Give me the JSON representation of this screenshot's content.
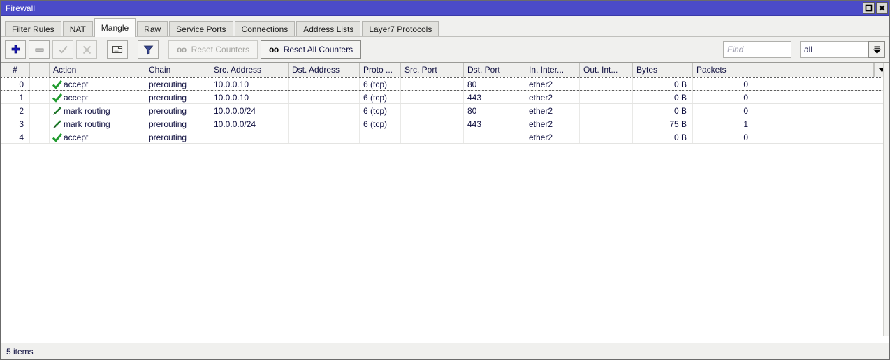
{
  "window": {
    "title": "Firewall",
    "titlebar_color": "#4b4bc8",
    "controls": [
      {
        "name": "maximize",
        "glyph": "maximize-icon"
      },
      {
        "name": "close",
        "glyph": "close-icon"
      }
    ]
  },
  "tabs": [
    {
      "label": "Filter Rules",
      "active": false
    },
    {
      "label": "NAT",
      "active": false
    },
    {
      "label": "Mangle",
      "active": true
    },
    {
      "label": "Raw",
      "active": false
    },
    {
      "label": "Service Ports",
      "active": false
    },
    {
      "label": "Connections",
      "active": false
    },
    {
      "label": "Address Lists",
      "active": false
    },
    {
      "label": "Layer7 Protocols",
      "active": false
    }
  ],
  "toolbar": {
    "buttons": [
      {
        "name": "add-button",
        "icon": "plus-icon",
        "enabled": true
      },
      {
        "name": "remove-button",
        "icon": "minus-icon",
        "enabled": true
      },
      {
        "name": "enable-button",
        "icon": "check-icon",
        "enabled": false
      },
      {
        "name": "disable-button",
        "icon": "cross-icon",
        "enabled": false
      },
      {
        "name": "comment-button",
        "icon": "comment-icon",
        "enabled": true
      },
      {
        "name": "filter-button",
        "icon": "funnel-icon",
        "enabled": true
      }
    ],
    "reset_counters": {
      "label": "Reset Counters",
      "badge": "oo",
      "enabled": false
    },
    "reset_all_counters": {
      "label": "Reset All Counters",
      "badge": "oo",
      "enabled": true
    },
    "find": {
      "placeholder": "Find",
      "value": ""
    },
    "filter_select": {
      "value": "all",
      "options": [
        "all"
      ]
    }
  },
  "table": {
    "columns": [
      {
        "key": "num",
        "label": "#",
        "width": 42,
        "align": "center"
      },
      {
        "key": "flags",
        "label": "",
        "width": 28,
        "align": "left"
      },
      {
        "key": "action",
        "label": "Action",
        "width": 137,
        "align": "left"
      },
      {
        "key": "chain",
        "label": "Chain",
        "width": 93,
        "align": "left"
      },
      {
        "key": "src",
        "label": "Src. Address",
        "width": 112,
        "align": "left"
      },
      {
        "key": "dst",
        "label": "Dst. Address",
        "width": 102,
        "align": "left"
      },
      {
        "key": "proto",
        "label": "Proto ...",
        "width": 59,
        "align": "left"
      },
      {
        "key": "sport",
        "label": "Src. Port",
        "width": 90,
        "align": "left"
      },
      {
        "key": "dport",
        "label": "Dst. Port",
        "width": 88,
        "align": "left"
      },
      {
        "key": "inif",
        "label": "In. Inter...",
        "width": 78,
        "align": "left"
      },
      {
        "key": "outif",
        "label": "Out. Int...",
        "width": 76,
        "align": "left"
      },
      {
        "key": "bytes",
        "label": "Bytes",
        "width": 86,
        "align": "right"
      },
      {
        "key": "pkts",
        "label": "Packets",
        "width": 88,
        "align": "right"
      }
    ],
    "rows": [
      {
        "num": "0",
        "flags": "",
        "action": "accept",
        "action_icon": "green-check-icon",
        "chain": "prerouting",
        "src": "10.0.0.10",
        "dst": "",
        "proto": "6 (tcp)",
        "sport": "",
        "dport": "80",
        "inif": "ether2",
        "outif": "",
        "bytes": "0 B",
        "pkts": "0",
        "selected": true
      },
      {
        "num": "1",
        "flags": "",
        "action": "accept",
        "action_icon": "green-check-icon",
        "chain": "prerouting",
        "src": "10.0.0.10",
        "dst": "",
        "proto": "6 (tcp)",
        "sport": "",
        "dport": "443",
        "inif": "ether2",
        "outif": "",
        "bytes": "0 B",
        "pkts": "0",
        "selected": false
      },
      {
        "num": "2",
        "flags": "",
        "action": "mark routing",
        "action_icon": "green-pencil-icon",
        "chain": "prerouting",
        "src": "10.0.0.0/24",
        "dst": "",
        "proto": "6 (tcp)",
        "sport": "",
        "dport": "80",
        "inif": "ether2",
        "outif": "",
        "bytes": "0 B",
        "pkts": "0",
        "selected": false
      },
      {
        "num": "3",
        "flags": "",
        "action": "mark routing",
        "action_icon": "green-pencil-icon",
        "chain": "prerouting",
        "src": "10.0.0.0/24",
        "dst": "",
        "proto": "6 (tcp)",
        "sport": "",
        "dport": "443",
        "inif": "ether2",
        "outif": "",
        "bytes": "75 B",
        "pkts": "1",
        "selected": false
      },
      {
        "num": "4",
        "flags": "",
        "action": "accept",
        "action_icon": "green-check-icon",
        "chain": "prerouting",
        "src": "",
        "dst": "",
        "proto": "",
        "sport": "",
        "dport": "",
        "inif": "ether2",
        "outif": "",
        "bytes": "0 B",
        "pkts": "0",
        "selected": false
      }
    ]
  },
  "statusbar": {
    "items_label": "5 items"
  }
}
